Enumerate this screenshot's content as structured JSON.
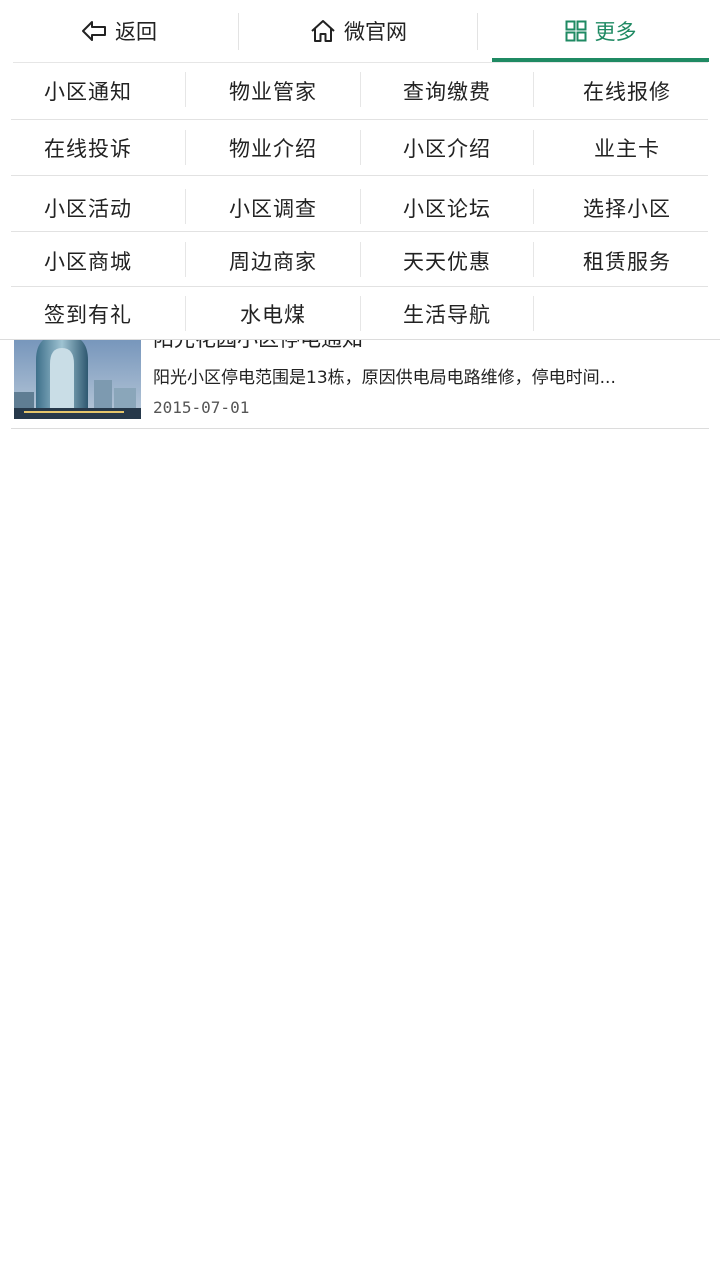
{
  "nav": {
    "back_label": "返回",
    "home_label": "微官网",
    "more_label": "更多",
    "back_icon": "back-arrow-icon",
    "home_icon": "home-icon",
    "more_icon": "grid-icon",
    "accent_color": "#1f8a63"
  },
  "menu": {
    "rows": [
      [
        "小区通知",
        "物业管家",
        "查询缴费",
        "在线报修"
      ],
      [
        "在线投诉",
        "物业介绍",
        "小区介绍",
        "业主卡"
      ],
      [
        "小区活动",
        "小区调查",
        "小区论坛",
        "选择小区"
      ],
      [
        "小区商城",
        "周边商家",
        "天天优惠",
        "租赁服务"
      ],
      [
        "签到有礼",
        "水电煤",
        "生活导航",
        ""
      ]
    ]
  },
  "news": {
    "items": [
      {
        "title": "阳光花园小区停电通知",
        "summary": "阳光小区停电范围是13栋，原因供电局电路维修，停电时间...",
        "date": "2015-07-01"
      }
    ]
  }
}
